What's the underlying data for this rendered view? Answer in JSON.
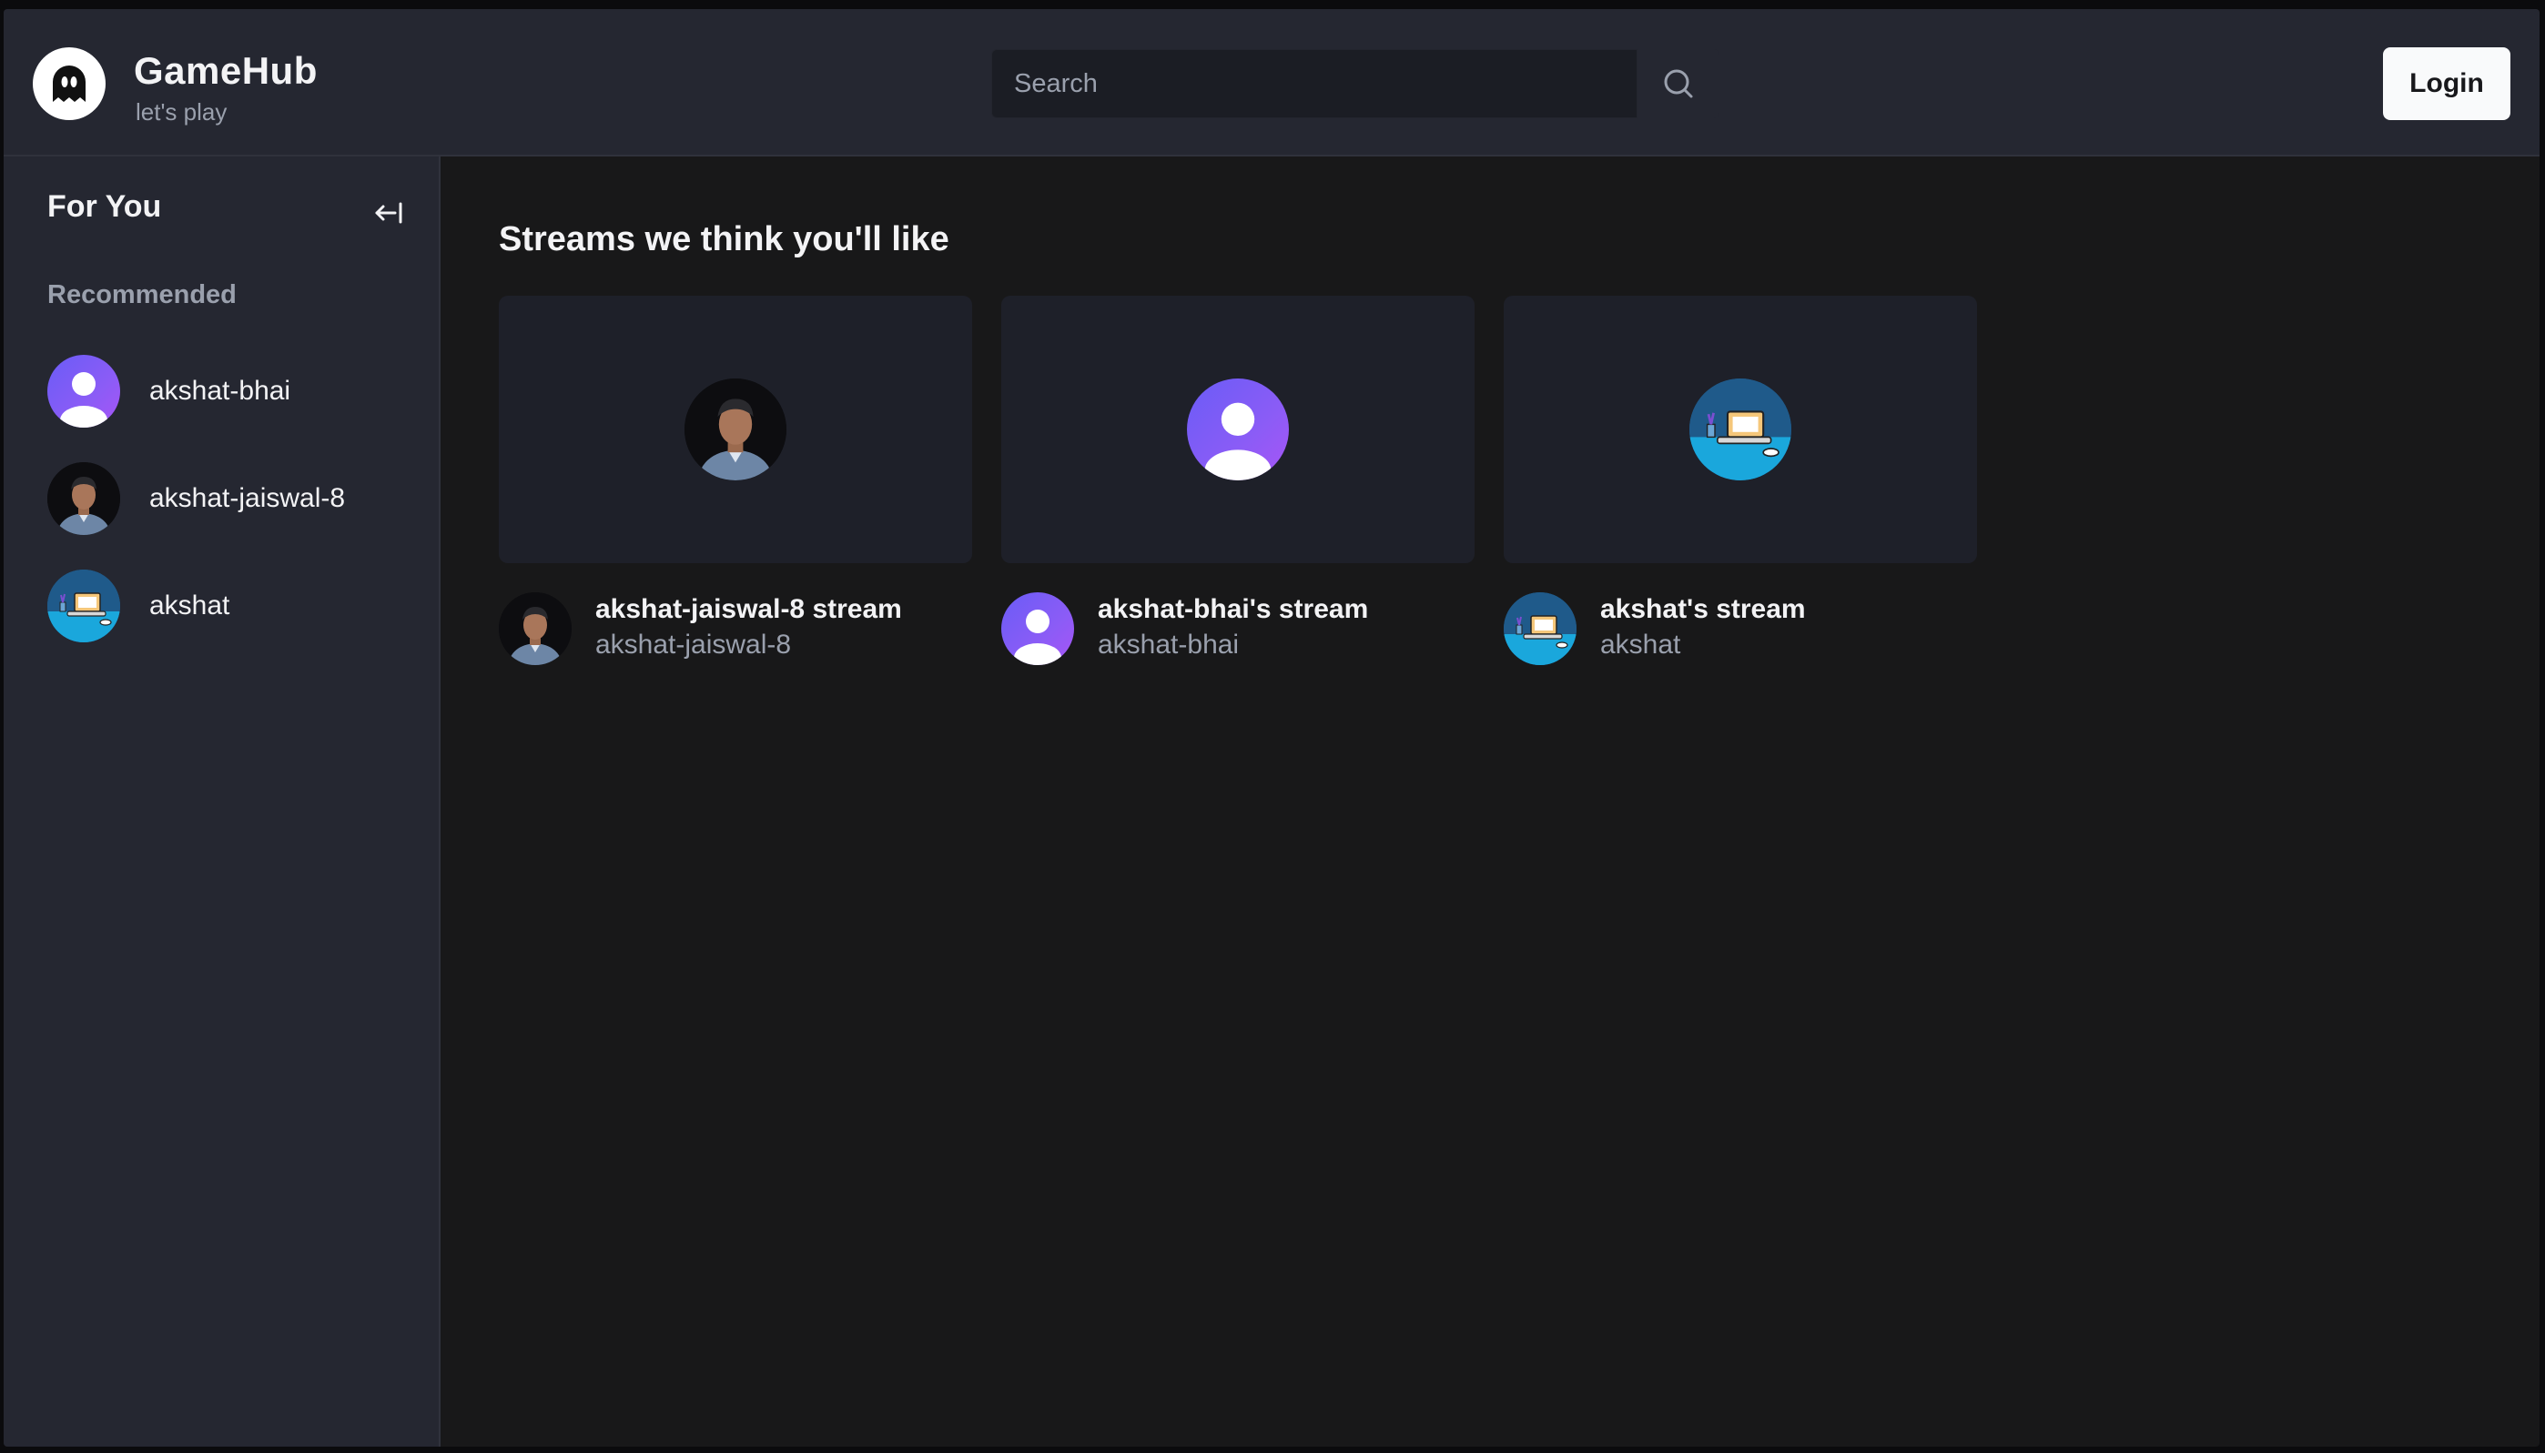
{
  "brand": {
    "title": "GameHub",
    "subtitle": "let's play",
    "logo_icon": "ghost-logo-icon"
  },
  "search": {
    "placeholder": "Search",
    "icon": "search-icon"
  },
  "auth": {
    "login_label": "Login"
  },
  "sidebar": {
    "title": "For You",
    "collapse_icon": "collapse-left-icon",
    "section_label": "Recommended",
    "items": [
      {
        "name": "akshat-bhai",
        "avatar": "default-avatar"
      },
      {
        "name": "akshat-jaiswal-8",
        "avatar": "photo-avatar"
      },
      {
        "name": "akshat",
        "avatar": "desk-illustration-avatar"
      }
    ]
  },
  "main": {
    "heading": "Streams we think you'll like",
    "streams": [
      {
        "title": "akshat-jaiswal-8 stream",
        "user": "akshat-jaiswal-8",
        "avatar": "photo-avatar"
      },
      {
        "title": "akshat-bhai's stream",
        "user": "akshat-bhai",
        "avatar": "default-avatar"
      },
      {
        "title": "akshat's stream",
        "user": "akshat",
        "avatar": "desk-illustration-avatar"
      }
    ]
  },
  "colors": {
    "header_bg": "#252731",
    "main_bg": "#181819",
    "card_bg": "#1e2029",
    "accent_purple": "#8b5cf6",
    "muted_text": "#9aa0ad"
  }
}
